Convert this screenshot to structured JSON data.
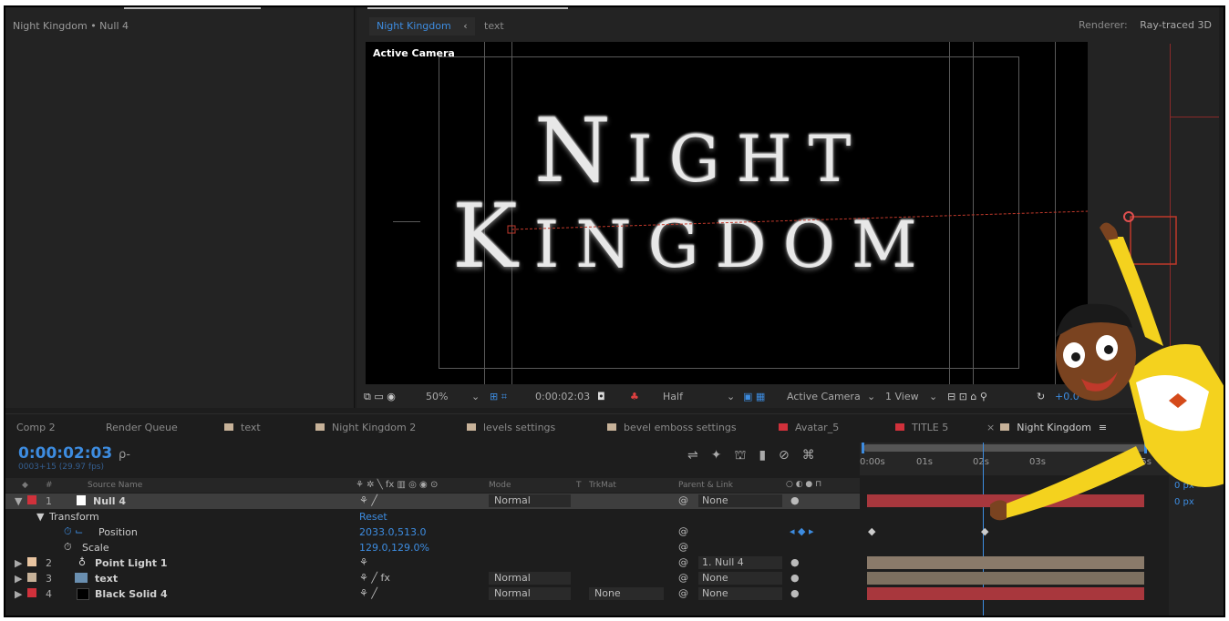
{
  "left_panel": {
    "title": "Night Kingdom • Null 4"
  },
  "viewer": {
    "tab_active": "Night Kingdom",
    "tab_inactive": "text",
    "renderer_label": "Renderer:",
    "renderer_value": "Ray-traced 3D",
    "active_camera": "Active Camera",
    "title_line1_cap": "N",
    "title_line1_rest": "IGHT",
    "title_line2_cap": "K",
    "title_line2_rest": "INGDOM",
    "zoom": "50%",
    "timecode": "0:00:02:03",
    "resolution": "Half",
    "camera_select": "Active Camera",
    "view_select": "1 View",
    "exposure": "+0.0"
  },
  "tabs": [
    {
      "label": "Comp 2",
      "color": ""
    },
    {
      "label": "Render Queue",
      "color": ""
    },
    {
      "label": "text",
      "color": "#c7b299"
    },
    {
      "label": "Night Kingdom 2",
      "color": "#c7b299"
    },
    {
      "label": "levels settings",
      "color": "#c7b299"
    },
    {
      "label": "bevel emboss settings",
      "color": "#c7b299"
    },
    {
      "label": "Avatar_5",
      "color": "#d0313b"
    },
    {
      "label": "TITLE 5",
      "color": "#d0313b"
    },
    {
      "label": "Night Kingdom",
      "color": "#c7b299"
    }
  ],
  "timeline": {
    "timecode": "0:00:02:03",
    "fps": "0003+15 (29.97 fps)",
    "search_placeholder": "ρ-",
    "ruler": [
      "0:00s",
      "01s",
      "02s",
      "03s",
      "05s"
    ],
    "headers": {
      "num": "#",
      "source": "Source Name",
      "mode": "Mode",
      "t": "T",
      "trkmat": "TrkMat",
      "parent": "Parent & Link"
    },
    "right_values": [
      "0 px",
      "0 px"
    ],
    "layers": [
      {
        "num": "1",
        "name": "Null 4",
        "label_color": "#d0313b",
        "mode": "Normal",
        "trkmat": "",
        "parent": "None",
        "bar_color": "#a8373d"
      },
      {
        "num": "2",
        "name": "Point Light 1",
        "label_color": "#e8c4a0",
        "mode": "",
        "trkmat": "",
        "parent": "1. Null 4",
        "bar_color": "#8a7a6a"
      },
      {
        "num": "3",
        "name": "text",
        "label_color": "#c7b299",
        "mode": "Normal",
        "trkmat": "",
        "parent": "None",
        "bar_color": "#7d7060"
      },
      {
        "num": "4",
        "name": "Black Solid 4",
        "label_color": "#d0313b",
        "mode": "Normal",
        "trkmat": "None",
        "parent": "None",
        "bar_color": "#a8373d"
      }
    ],
    "transform": {
      "label": "Transform",
      "reset": "Reset",
      "position_label": "Position",
      "position_value": "2033.0,513.0",
      "scale_label": "Scale",
      "scale_value": "129.0,129.0%"
    }
  },
  "colors": {
    "accent_blue": "#3d8ce0",
    "panel": "#232323",
    "background": "#1d1d1d"
  }
}
